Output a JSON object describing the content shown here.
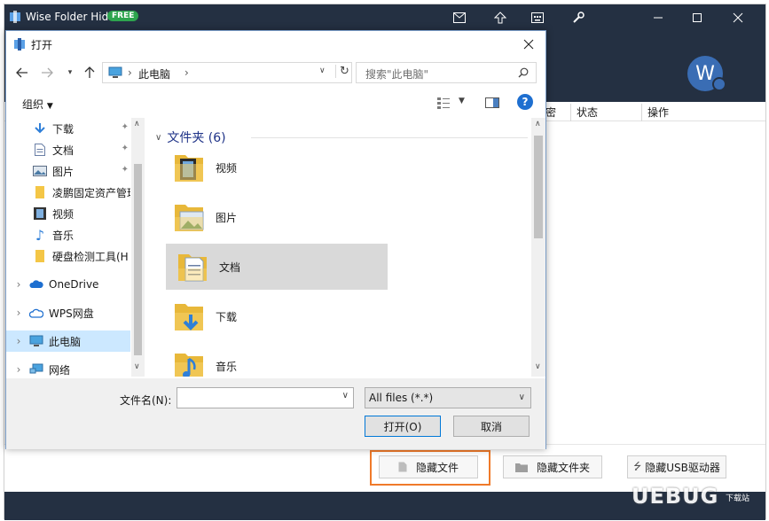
{
  "main_window": {
    "title": "Wise Folder Hider",
    "badge": "FREE",
    "avatar_letter": "W",
    "title_icons": [
      "mail-icon",
      "upgrade-icon",
      "keyboard-icon",
      "settings-icon",
      "minimize-icon",
      "maximize-icon",
      "close-icon"
    ],
    "table_columns": [
      "密",
      "状态",
      "操作"
    ],
    "buttons": {
      "hide_file": "隐藏文件",
      "hide_folder": "隐藏文件夹",
      "hide_usb": "隐藏USB驱动器"
    },
    "watermark": "UEBUG",
    "watermark_sub": "下载站",
    "colors": {
      "header_bg": "#243042",
      "badge": "#2da44e",
      "highlight": "#f07a2a"
    }
  },
  "dialog": {
    "title": "打开",
    "address": "此电脑",
    "search_placeholder": "搜索\"此电脑\"",
    "organize": "组织",
    "sidebar": [
      {
        "label": "下载",
        "icon": "download-arrow-icon",
        "pinned": true
      },
      {
        "label": "文档",
        "icon": "document-icon",
        "pinned": true
      },
      {
        "label": "图片",
        "icon": "pictures-icon",
        "pinned": true
      },
      {
        "label": "凌鹏固定资产管理",
        "icon": "folder-icon",
        "pinned": false
      },
      {
        "label": "视频",
        "icon": "video-icon",
        "pinned": false
      },
      {
        "label": "音乐",
        "icon": "music-icon",
        "pinned": false
      },
      {
        "label": "硬盘检测工具(H",
        "icon": "folder-icon",
        "pinned": false
      },
      {
        "label": "OneDrive",
        "icon": "cloud-icon",
        "pinned": false
      },
      {
        "label": "WPS网盘",
        "icon": "cloud-outline-icon",
        "pinned": false
      },
      {
        "label": "此电脑",
        "icon": "computer-icon",
        "pinned": false
      },
      {
        "label": "网络",
        "icon": "network-icon",
        "pinned": false
      }
    ],
    "group_header": "文件夹 (6)",
    "items": [
      {
        "label": "视频",
        "icon": "video-folder-icon"
      },
      {
        "label": "图片",
        "icon": "pictures-folder-icon"
      },
      {
        "label": "文档",
        "icon": "documents-folder-icon"
      },
      {
        "label": "下载",
        "icon": "downloads-folder-icon"
      },
      {
        "label": "音乐",
        "icon": "music-folder-icon"
      }
    ],
    "filename_label": "文件名(N):",
    "filename_value": "",
    "filetype": "All files (*.*)",
    "open_button": "打开(O)",
    "cancel_button": "取消"
  }
}
